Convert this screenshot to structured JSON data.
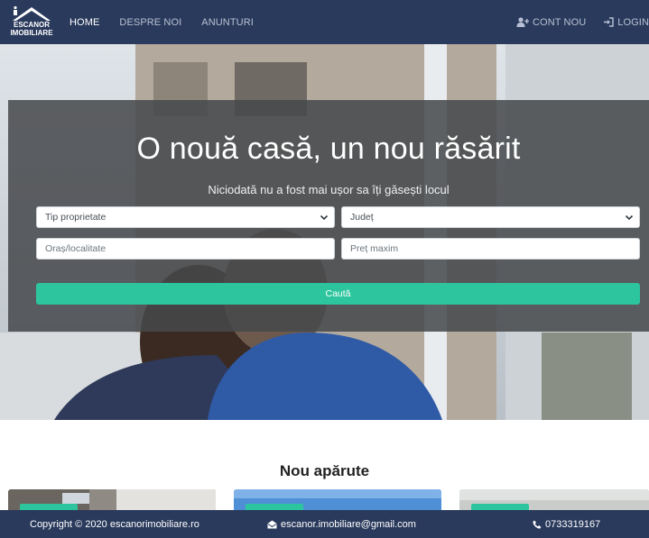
{
  "nav": {
    "brand_line1": "ESCANOR",
    "brand_line2": "IMOBILIARE",
    "links": [
      {
        "label": "HOME",
        "active": true
      },
      {
        "label": "DESPRE NOI",
        "active": false
      },
      {
        "label": "ANUNTURI",
        "active": false
      }
    ],
    "register_label": "CONT NOU",
    "login_label": "LOGIN"
  },
  "hero": {
    "title": "O nouă casă, un nou răsărit",
    "subtitle": "Niciodată nu a fost mai ușor sa îți găsești locul",
    "property_type_select": "Tip proprietate",
    "county_select": "Județ",
    "city_placeholder": "Oraș/localitate",
    "max_price_placeholder": "Preț maxim",
    "search_button": "Caută"
  },
  "listings": {
    "title": "Nou apărute"
  },
  "footer": {
    "copyright": "Copyright © 2020 escanorimobiliare.ro",
    "email": "escanor.imobiliare@gmail.com",
    "phone": "0733319167"
  },
  "colors": {
    "navbar": "#2a3a5c",
    "accent": "#2dc59d",
    "overlay": "#46484c"
  }
}
